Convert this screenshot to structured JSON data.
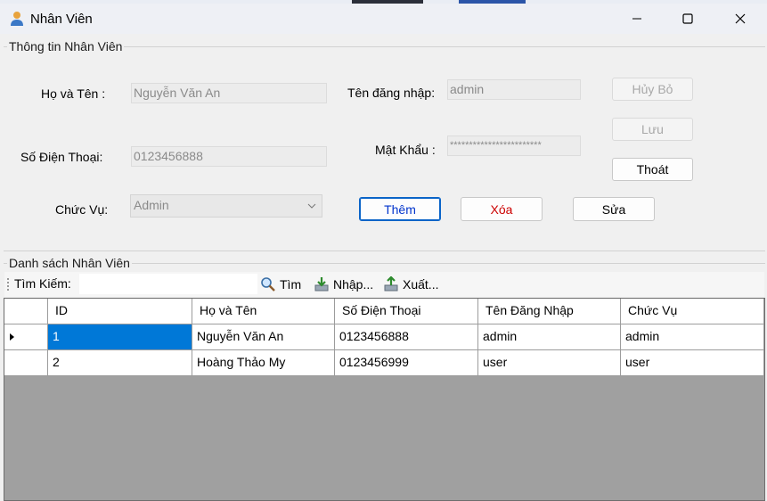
{
  "window": {
    "title": "Nhân Viên"
  },
  "info_group": {
    "title": "Thông tin Nhân Viên",
    "name_label": "Họ và Tên :",
    "name_value": "Nguyễn Văn An",
    "username_label": "Tên đăng nhập:",
    "username_value": "admin",
    "phone_label": "Số Điện Thoại:",
    "phone_value": "0123456888",
    "password_label": "Mật Khẩu :",
    "password_value": "************************",
    "role_label": "Chức Vụ:",
    "role_value": "Admin"
  },
  "buttons": {
    "cancel": "Hủy Bỏ",
    "save": "Lưu",
    "exit": "Thoát",
    "add": "Thêm",
    "delete": "Xóa",
    "edit": "Sửa"
  },
  "colors": {
    "add_text": "#0033cc",
    "delete_text": "#cc0000",
    "selection": "#0078d7"
  },
  "list_group": {
    "title": "Danh sách Nhân Viên"
  },
  "toolbar": {
    "search_label": "Tìm Kiếm:",
    "search_value": "",
    "find_label": "Tìm",
    "import_label": "Nhập...",
    "export_label": "Xuất...",
    "icons": [
      "magnifier-icon",
      "import-icon",
      "export-icon"
    ]
  },
  "table": {
    "columns": [
      "ID",
      "Họ và Tên",
      "Số Điện Thoại",
      "Tên Đăng Nhập",
      "Chức Vụ"
    ],
    "rows": [
      [
        "1",
        "Nguyễn Văn An",
        "0123456888",
        "admin",
        "admin"
      ],
      [
        "2",
        "Hoàng Thảo My",
        "0123456999",
        "user",
        "user"
      ]
    ],
    "selected_row": 0
  }
}
